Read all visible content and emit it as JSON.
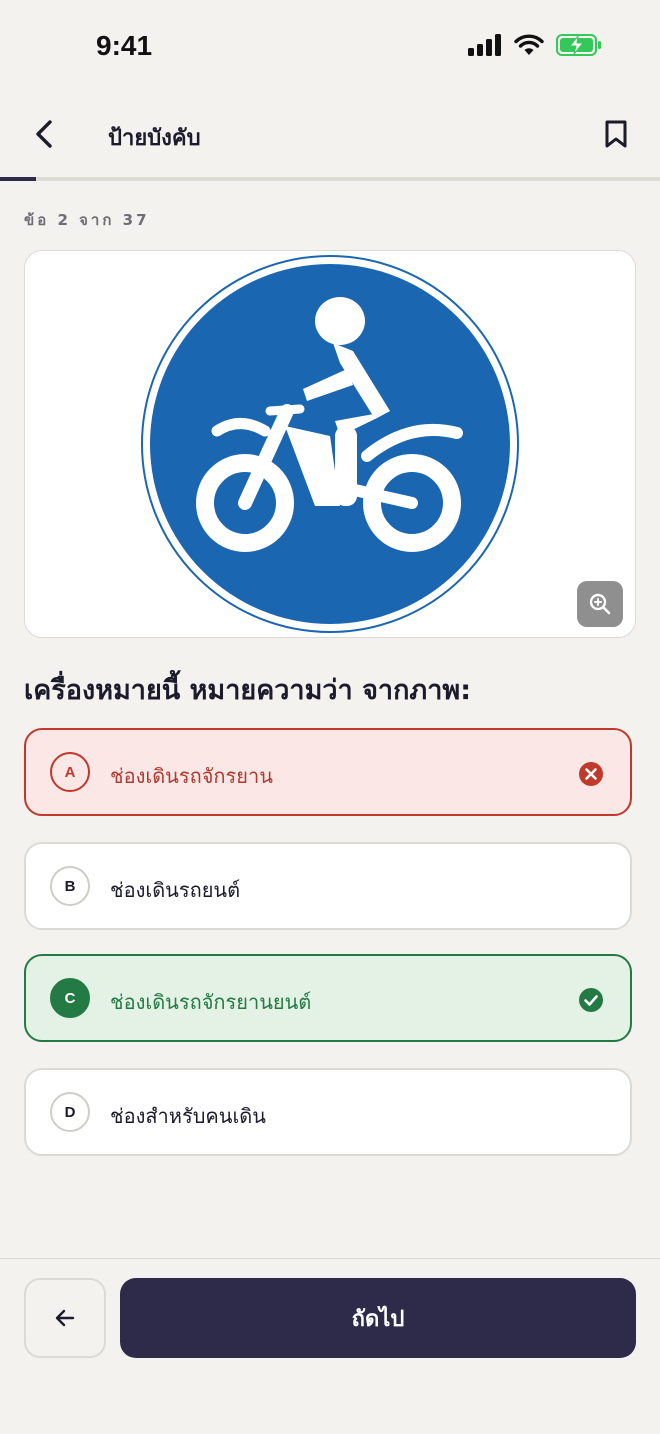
{
  "status_bar": {
    "time": "9:41"
  },
  "header": {
    "title": "ป้ายบังคับ",
    "back_icon": "chevron-left-icon",
    "bookmark_icon": "bookmark-icon"
  },
  "progress": {
    "current": 2,
    "total": 37,
    "label": "ข้อ 2 จาก 37"
  },
  "question": {
    "text": "เครื่องหมายนี้ หมายความว่า จากภาพ:",
    "zoom_icon": "zoom-in-icon"
  },
  "options": [
    {
      "letter": "A",
      "text": "ช่องเดินรถจักรยาน",
      "state": "wrong"
    },
    {
      "letter": "B",
      "text": "ช่องเดินรถยนต์",
      "state": "default"
    },
    {
      "letter": "C",
      "text": "ช่องเดินรถจักรยานยนต์",
      "state": "correct"
    },
    {
      "letter": "D",
      "text": "ช่องสำหรับคนเดิน",
      "state": "default"
    }
  ],
  "footer": {
    "next_label": "ถัดไป",
    "prev_icon": "arrow-left-icon"
  },
  "colors": {
    "primary": "#2d2a4a",
    "background": "#f3f2ef",
    "sign_blue": "#1b66b1",
    "wrong": "#c0392b",
    "correct": "#237a45",
    "battery": "#34c759"
  }
}
